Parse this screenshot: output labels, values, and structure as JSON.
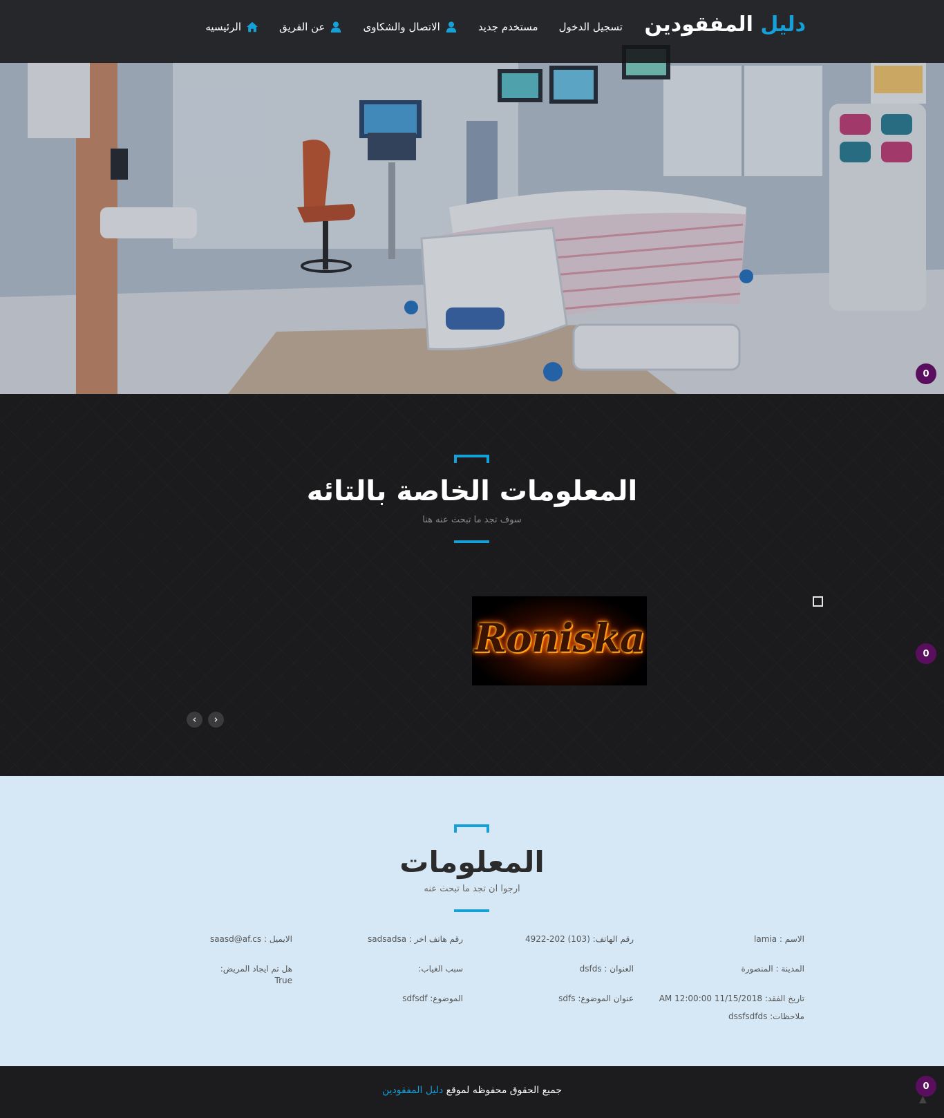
{
  "brand": {
    "accent": "دليل",
    "rest": " المفقودين"
  },
  "nav": [
    {
      "label": "الرئيسيه",
      "icon": "home-icon"
    },
    {
      "label": "عن الفريق",
      "icon": "user-icon"
    },
    {
      "label": "الاتصال والشكاوى",
      "icon": "user-icon"
    },
    {
      "label": "مستخدم جديد",
      "icon": ""
    },
    {
      "label": "تسجيل الدخول",
      "icon": ""
    }
  ],
  "badges": {
    "hero": "0",
    "carousel": "0",
    "footer": "0"
  },
  "section1": {
    "title": "المعلومات الخاصة بالتائه",
    "subtitle": "سوف تجد ما تبحث عنه هنا",
    "image_text": "Roniska",
    "prev_arrow": "‹",
    "next_arrow": "›"
  },
  "section2": {
    "title": "المعلومات",
    "subtitle": "ارجوا ان تجد ما تبحث عنه",
    "fields": {
      "name": "الاسم : lamia",
      "phone": "رقم الهاتف: (103) 202-4922",
      "other_phone": "رقم هاتف اخر : sadsadsa",
      "email": "الايميل : saasd@af.cs",
      "city": "المدينة : المنصورة",
      "address": "العنوان : dsfds",
      "absence_reason": "سبب الغياب:",
      "found_q": "هل تم ايجاد المريض:",
      "found_val": "True",
      "lost_date": "تاريخ الفقد: 11/15/2018 12:00:00 AM",
      "topic_title": "عنوان الموضوع: sdfs",
      "topic": "الموضوع: sdfsdf",
      "notes": "ملاحظات: dssfsdfds"
    }
  },
  "footer": {
    "text": "جميع الحقوق محفوظه لموقع",
    "link": "دليل المفقودين"
  },
  "colors": {
    "accent": "#16a0d8",
    "badge": "#5a0f5e",
    "dark_bg": "#1b1b1d",
    "light_bg": "#d6e8f6"
  }
}
